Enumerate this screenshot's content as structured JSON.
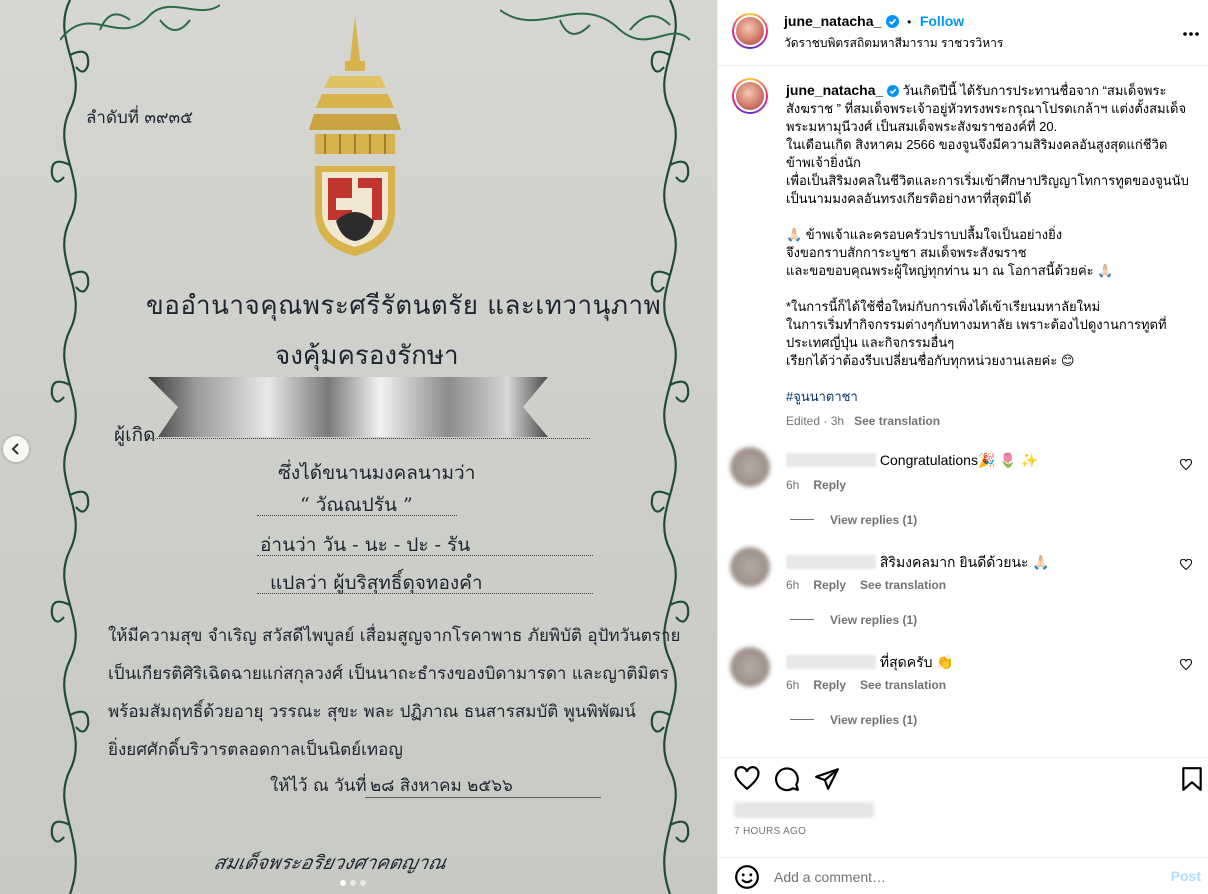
{
  "certificate": {
    "serial": "ลำดับที่ ๓๙๓๕",
    "line1": "ขออำนาจคุณพระศรีรัตนตรัย และเทวานุภาพ",
    "line2": "จงคุ้มครองรักษา",
    "born_label": "ผู้เกิด",
    "granted_label": "ซึ่งได้ขนานมงคลนามว่า",
    "name": "“ วัณณปรัน ”",
    "reading": "อ่านว่า  วัน - นะ - ปะ - รัน",
    "meaning": "แปลว่า  ผู้บริสุทธิ์ดุจทองคำ",
    "blessing1": "ให้มีความสุข จำเริญ สวัสดีไพบูลย์ เสื่อมสูญจากโรคาพาธ ภัยพิบัติ อุปัทวันตราย",
    "blessing2": "เป็นเกียรติศิริเฉิดฉายแก่สกุลวงศ์ เป็นนาถะธำรงของบิดามารดา และญาติมิตร",
    "blessing3": "พร้อมสัมฤทธิ์ด้วยอายุ วรรณะ สุขะ พละ ปฏิภาณ ธนสารสมบัติ พูนพิพัฒน์",
    "blessing4": "ยิ่งยศศักดิ์บริวารตลอดกาลเป็นนิตย์เทอญ",
    "given_at": "ให้ไว้ ณ วันที่",
    "date": "๒๘ สิงหาคม ๒๕๖๖",
    "signature": "สมเด็จพระอริยวงศาคตญาณ",
    "carousel_dots": 3,
    "active_dot": 1
  },
  "header": {
    "username": "june_natacha_",
    "follow_label": "Follow",
    "bullet": "•",
    "location": "วัดราชบพิตรสถิตมหาสีมาราม ราชวรวิหาร",
    "more_icon": "more-horizontal-icon"
  },
  "caption": {
    "username": "june_natacha_",
    "line1": " วันเกิดปีนี้ ได้รับการประทานชื่อจาก “สมเด็จพระสังฆราช ” ที่สมเด็จพระเจ้าอยู่หัวทรงพระกรุณาโปรดเกล้าฯ แต่งตั้งสมเด็จพระมหามุนีวงศ์ เป็นสมเด็จพระสังฆราชองค์ที่ 20.",
    "line2": "ในเดือนเกิด สิงหาคม 2566 ของจูนจึงมีความสิริมงคลอันสูงสุดแก่ชีวิตข้าพเจ้ายิ่งนัก",
    "line3": "เพื่อเป็นสิริมงคลในชีวิตและการเริ่มเข้าศึกษาปริญญาโทการทูตของจูนนับเป็นนามมงคลอันทรงเกียรติอย่างหาที่สุดมิได้",
    "line4": "🙏🏻 ข้าพเจ้าและครอบครัวปราบปลื้มใจเป็นอย่างยิ่ง",
    "line5": "จึงขอกราบสักการะบูชา สมเด็จพระสังฆราช",
    "line6": "และขอขอบคุณพระผู้ใหญ่ทุกท่าน มา ณ โอกาสนี้ด้วยค่ะ 🙏🏻",
    "line7": "*ในการนี้ก็ได้ใช้ชื่อใหม่กับการเพิ่งได้เข้าเรียนมหาลัยใหม่",
    "line8": "ในการเริ่มทำกิจกรรมต่างๆกับทางมหาลัย เพราะต้องไปดูงานการทูตที่ประเทศญี่ปุ่น และกิจกรรมอื่นๆ",
    "line9": "เรียกได้ว่าต้องรีบเปลี่ยนชื่อกับทุกหน่วยงานเลยค่ะ 😊",
    "hashtag": "#จูนนาตาชา",
    "edited": "Edited · 3h",
    "see_translation": "See translation"
  },
  "comments": [
    {
      "text": "Congratulations🎉 🌷 ✨",
      "time": "6h",
      "reply": "Reply",
      "translation": "",
      "view_replies": "View replies (1)"
    },
    {
      "text": "สิริมงคลมาก ยินดีด้วยนะ 🙏🏻",
      "time": "6h",
      "reply": "Reply",
      "translation": "See translation",
      "view_replies": "View replies (1)"
    },
    {
      "text": "ที่สุดครับ 👏",
      "time": "6h",
      "reply": "Reply",
      "translation": "See translation",
      "view_replies": "View replies (1)"
    }
  ],
  "actions": {
    "time": "7 HOURS AGO"
  },
  "add_comment": {
    "placeholder": "Add a comment…",
    "post_label": "Post"
  },
  "colors": {
    "accent": "#0095f6",
    "border_green": "#1f5a3a",
    "gold": "#d8b24a",
    "paper": "#d2d3ce"
  }
}
